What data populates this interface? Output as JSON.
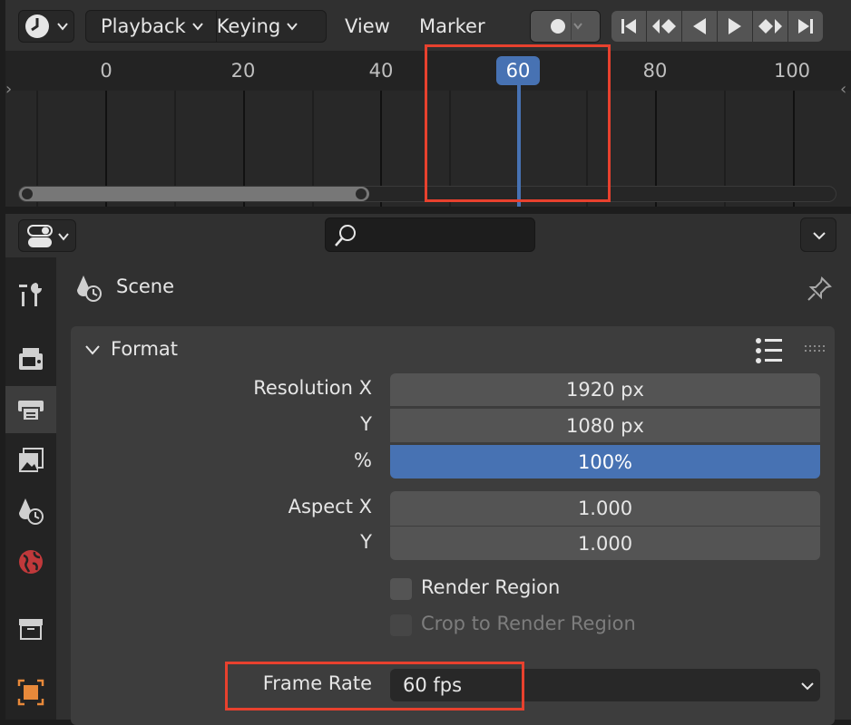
{
  "timeline": {
    "menus": {
      "playback": "Playback",
      "keying": "Keying",
      "view": "View",
      "marker": "Marker"
    },
    "ruler_labels": [
      "0",
      "20",
      "40",
      "60",
      "80",
      "100"
    ],
    "current_frame": "60",
    "playback_buttons": [
      "jump-to-start-icon",
      "prev-keyframe-icon",
      "play-reverse-icon",
      "play-icon",
      "next-keyframe-icon",
      "jump-to-end-icon"
    ]
  },
  "properties": {
    "context": "Scene",
    "panel": {
      "title": "Format",
      "resolution_x_label": "Resolution X",
      "resolution_x": "1920 px",
      "resolution_y_label": "Y",
      "resolution_y": "1080 px",
      "percent_label": "%",
      "percent": "100%",
      "aspect_x_label": "Aspect X",
      "aspect_x": "1.000",
      "aspect_y_label": "Y",
      "aspect_y": "1.000",
      "render_region": "Render Region",
      "crop_to_render_region": "Crop to Render Region",
      "frame_rate_label": "Frame Rate",
      "frame_rate": "60 fps"
    },
    "tabs": [
      "tool-icon",
      "render-icon",
      "output-icon",
      "view-layer-icon",
      "scene-icon",
      "world-icon",
      "collection-icon",
      "texture-icon"
    ]
  },
  "colors": {
    "accent": "#4772b3",
    "highlight": "#e8412e"
  }
}
